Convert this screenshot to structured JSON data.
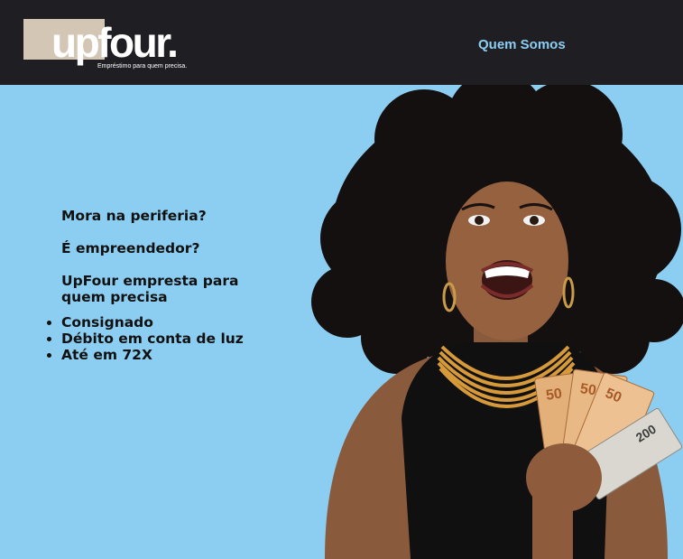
{
  "header": {
    "logo_text": "upfour.",
    "tagline": "Empréstimo para quem precisa.",
    "nav": {
      "quem_somos": "Quem Somos"
    }
  },
  "hero": {
    "lines": [
      "Mora na periferia?",
      "É empreendedor?",
      "UpFour empresta para quem precisa"
    ],
    "bullets": [
      "Consignado",
      "Débito em conta de luz",
      "Até em 72X"
    ],
    "bill_labels": [
      "50",
      "50",
      "50",
      "200"
    ]
  },
  "colors": {
    "header_bg": "#1f1e23",
    "page_bg": "#8ccef2",
    "accent": "#8ccef2",
    "logo_block": "#d3c6b5"
  }
}
